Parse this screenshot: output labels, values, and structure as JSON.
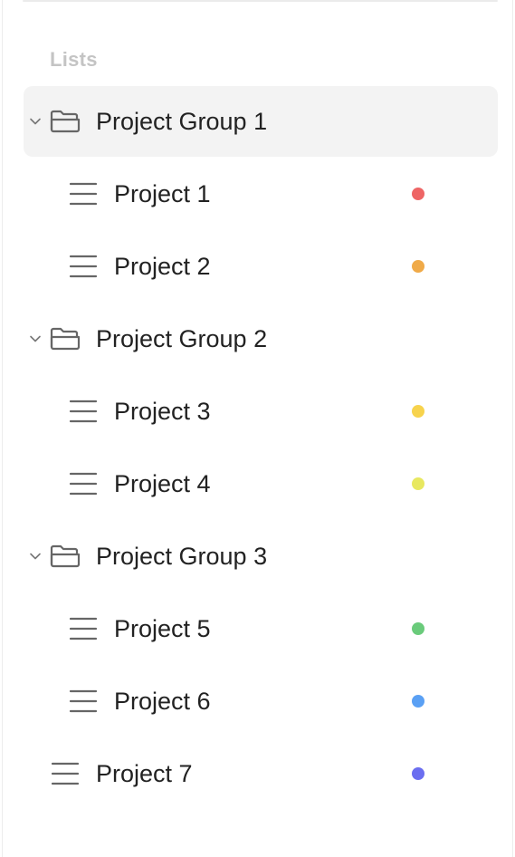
{
  "sidebar": {
    "section_title": "Lists",
    "groups": [
      {
        "label": "Project Group 1",
        "expanded": true,
        "selected": true,
        "projects": [
          {
            "label": "Project 1",
            "color": "#ee6565"
          },
          {
            "label": "Project 2",
            "color": "#f0aa48"
          }
        ]
      },
      {
        "label": "Project Group 2",
        "expanded": true,
        "selected": false,
        "projects": [
          {
            "label": "Project 3",
            "color": "#f7d34d"
          },
          {
            "label": "Project 4",
            "color": "#e8e860"
          }
        ]
      },
      {
        "label": "Project Group 3",
        "expanded": true,
        "selected": false,
        "projects": [
          {
            "label": "Project 5",
            "color": "#6acb7b"
          },
          {
            "label": "Project 6",
            "color": "#5aa0f4"
          }
        ]
      }
    ],
    "standalone": [
      {
        "label": "Project 7",
        "color": "#6b6ef0"
      }
    ]
  }
}
